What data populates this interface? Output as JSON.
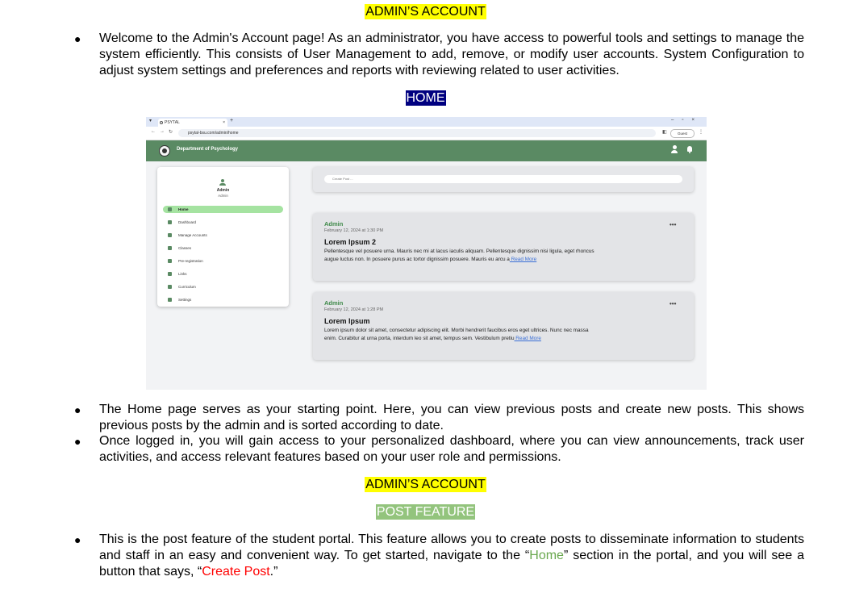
{
  "heading1": "ADMIN’S ACCOUNT",
  "intro": "Welcome to the Admin's Account page! As an administrator, you have access to powerful tools and settings to manage the system efficiently. This consists of User Management to add, remove, or modify user accounts. System Configuration to adjust system settings and preferences and reports with reviewing related to user activities.",
  "home_label": "HOME",
  "screenshot": {
    "tab_title": "PSYTAL",
    "url": "psytal-bsu.com/admin/home",
    "guest_label": "Guest",
    "dept_name": "Department of Psychology",
    "sidebar": {
      "name": "Admin",
      "role": "Admin",
      "items": [
        "Home",
        "Dashboard",
        "Manage Accounts",
        "Classes",
        "Pre-registration",
        "Links",
        "Curriculum",
        "Settings"
      ]
    },
    "create_placeholder": "Create Post ...",
    "posts": [
      {
        "author": "Admin",
        "date": "February 12, 2024 at 1:30 PM",
        "title": "Lorem Ipsum 2",
        "body": "Pellentesque vel posuere urna. Mauris nec mi at lacus iaculis aliquam. Pellentesque dignissim nisi ligula, eget rhoncus augue luctus non. In posuere purus ac tortor dignissim posuere. Mauris eu arcu a",
        "read_more": " Read More"
      },
      {
        "author": "Admin",
        "date": "February 12, 2024 at 1:28 PM",
        "title": "Lorem Ipsum",
        "body": "Lorem ipsum dolor sit amet, consectetur adipiscing elit. Morbi hendrerit faucibus eros eget ultrices. Nunc nec massa enim. Curabitur at urna porta, interdum leo sit amet, tempus sem. Vestibulum pretiu",
        "read_more": " Read More"
      }
    ]
  },
  "bullet2": "The Home page serves as your starting point. Here, you can view previous posts and create new posts. This shows previous posts by the admin and is sorted according to date.",
  "bullet3": "Once logged in, you will gain access to your personalized dashboard, where you can view announcements, track user activities, and access relevant features based on your user role and permissions.",
  "heading2": "ADMIN’S ACCOUNT",
  "post_feature_label": "POST FEATURE",
  "bullet4": {
    "part1": "This is the post feature of the student portal. This feature allows you to create posts to disseminate information to students and staff in an easy and convenient way. To get started, navigate to the “",
    "home_word": "Home",
    "part2": "” section in the portal, and you will see a button that says, “",
    "create_word": "Create Post",
    "part3": ".”"
  },
  "colors": {
    "highlight_yellow": "#ffff00",
    "highlight_navy": "#000080",
    "highlight_green": "#93c47d",
    "app_green": "#5a8a63"
  }
}
